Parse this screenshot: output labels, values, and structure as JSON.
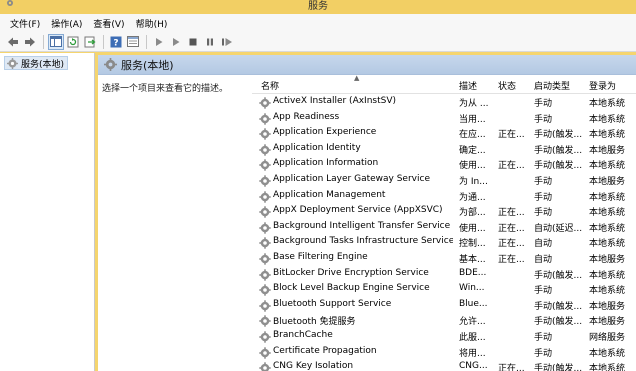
{
  "window": {
    "title": "服务"
  },
  "menu": [
    {
      "label": "文件(F)"
    },
    {
      "label": "操作(A)"
    },
    {
      "label": "查看(V)"
    },
    {
      "label": "帮助(H)"
    }
  ],
  "toolbar": {
    "buttons": [
      "back-icon",
      "forward-icon",
      "show-tree-icon",
      "refresh-icon",
      "export-icon",
      "help-icon",
      "properties-icon",
      "play-icon",
      "play-alt-icon",
      "stop-icon",
      "pause-icon",
      "restart-icon"
    ]
  },
  "tree": {
    "root_label": "服务(本地)"
  },
  "pane": {
    "title": "服务(本地)",
    "description": "选择一个项目来查看它的描述。"
  },
  "columns": {
    "name": "名称",
    "description": "描述",
    "status": "状态",
    "startup": "启动类型",
    "logon": "登录为"
  },
  "rows": [
    {
      "name": "ActiveX Installer (AxInstSV)",
      "description": "为从 ...",
      "status": "",
      "startup": "手动",
      "logon": "本地系统"
    },
    {
      "name": "App Readiness",
      "description": "当用...",
      "status": "",
      "startup": "手动",
      "logon": "本地系统"
    },
    {
      "name": "Application Experience",
      "description": "在应...",
      "status": "正在...",
      "startup": "手动(触发...",
      "logon": "本地系统"
    },
    {
      "name": "Application Identity",
      "description": "确定...",
      "status": "",
      "startup": "手动(触发...",
      "logon": "本地服务"
    },
    {
      "name": "Application Information",
      "description": "使用...",
      "status": "正在...",
      "startup": "手动(触发...",
      "logon": "本地系统"
    },
    {
      "name": "Application Layer Gateway Service",
      "description": "为 In...",
      "status": "",
      "startup": "手动",
      "logon": "本地服务"
    },
    {
      "name": "Application Management",
      "description": "为通...",
      "status": "",
      "startup": "手动",
      "logon": "本地系统"
    },
    {
      "name": "AppX Deployment Service (AppXSVC)",
      "description": "为部...",
      "status": "正在...",
      "startup": "手动",
      "logon": "本地系统"
    },
    {
      "name": "Background Intelligent Transfer Service",
      "description": "使用...",
      "status": "正在...",
      "startup": "自动(延迟...",
      "logon": "本地系统"
    },
    {
      "name": "Background Tasks Infrastructure Service",
      "description": "控制...",
      "status": "正在...",
      "startup": "自动",
      "logon": "本地系统"
    },
    {
      "name": "Base Filtering Engine",
      "description": "基本...",
      "status": "正在...",
      "startup": "自动",
      "logon": "本地服务"
    },
    {
      "name": "BitLocker Drive Encryption Service",
      "description": "BDE...",
      "status": "",
      "startup": "手动(触发...",
      "logon": "本地系统"
    },
    {
      "name": "Block Level Backup Engine Service",
      "description": "Win...",
      "status": "",
      "startup": "手动",
      "logon": "本地系统"
    },
    {
      "name": "Bluetooth Support Service",
      "description": "Blue...",
      "status": "",
      "startup": "手动(触发...",
      "logon": "本地服务"
    },
    {
      "name": "Bluetooth 免提服务",
      "description": "允许...",
      "status": "",
      "startup": "手动(触发...",
      "logon": "本地服务"
    },
    {
      "name": "BranchCache",
      "description": "此服...",
      "status": "",
      "startup": "手动",
      "logon": "网络服务"
    },
    {
      "name": "Certificate Propagation",
      "description": "将用...",
      "status": "",
      "startup": "手动",
      "logon": "本地系统"
    },
    {
      "name": "CNG Key Isolation",
      "description": "CNG...",
      "status": "正在...",
      "startup": "手动(触发...",
      "logon": "本地系统"
    }
  ]
}
